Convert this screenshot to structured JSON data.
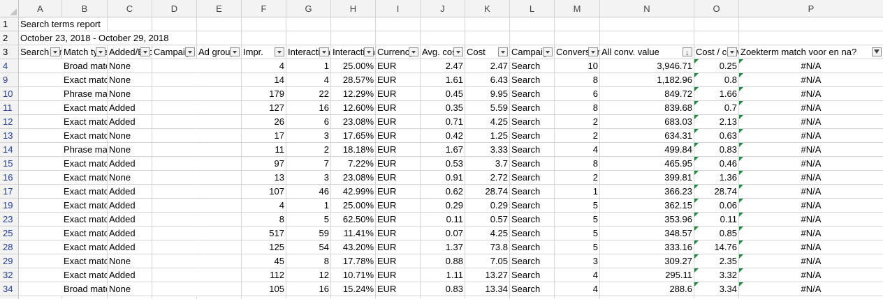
{
  "columns": [
    {
      "letter": "A",
      "width": 62
    },
    {
      "letter": "B",
      "width": 65
    },
    {
      "letter": "C",
      "width": 64
    },
    {
      "letter": "D",
      "width": 64
    },
    {
      "letter": "E",
      "width": 64
    },
    {
      "letter": "F",
      "width": 64
    },
    {
      "letter": "G",
      "width": 64
    },
    {
      "letter": "H",
      "width": 64
    },
    {
      "letter": "I",
      "width": 64
    },
    {
      "letter": "J",
      "width": 64
    },
    {
      "letter": "K",
      "width": 64
    },
    {
      "letter": "L",
      "width": 64
    },
    {
      "letter": "M",
      "width": 65
    },
    {
      "letter": "N",
      "width": 135
    },
    {
      "letter": "O",
      "width": 64
    },
    {
      "letter": "P",
      "width": 207
    }
  ],
  "title_row": {
    "row": "1",
    "text": "Search terms report"
  },
  "date_row": {
    "row": "2",
    "text": "October 23, 2018 - October 29, 2018"
  },
  "header_row": {
    "row": "3",
    "cells": [
      {
        "text": "Search terms",
        "filter": "dropdown"
      },
      {
        "text": "Match type",
        "filter": "dropdown"
      },
      {
        "text": "Added/Excluded",
        "filter": "dropdown"
      },
      {
        "text": "Campaign",
        "filter": "dropdown"
      },
      {
        "text": "Ad group",
        "filter": "dropdown"
      },
      {
        "text": "Impr.",
        "filter": "dropdown"
      },
      {
        "text": "Interactions",
        "filter": "dropdown"
      },
      {
        "text": "Interaction rate",
        "filter": "dropdown"
      },
      {
        "text": "Currency",
        "filter": "dropdown"
      },
      {
        "text": "Avg. cost",
        "filter": "dropdown"
      },
      {
        "text": "Cost",
        "filter": "dropdown"
      },
      {
        "text": "Campaign type",
        "filter": "dropdown"
      },
      {
        "text": "Conversions",
        "filter": "dropdown"
      },
      {
        "text": "All conv. value",
        "filter": "sorted"
      },
      {
        "text": "Cost / conv.",
        "filter": "dropdown"
      },
      {
        "text": "Zoekterm match voor en na?",
        "filter": "filtered"
      }
    ]
  },
  "data_rows": [
    {
      "row": "4",
      "cells": [
        "",
        "Broad match",
        "None",
        "",
        "",
        "4",
        "1",
        "25.00%",
        "EUR",
        "2.47",
        "2.47",
        "Search",
        "10",
        "3,946.71",
        "0.25",
        "#N/A"
      ]
    },
    {
      "row": "9",
      "cells": [
        "",
        "Exact match",
        "None",
        "",
        "",
        "14",
        "4",
        "28.57%",
        "EUR",
        "1.61",
        "6.43",
        "Search",
        "8",
        "1,182.96",
        "0.8",
        "#N/A"
      ]
    },
    {
      "row": "10",
      "cells": [
        "",
        "Phrase match",
        "None",
        "",
        "",
        "179",
        "22",
        "12.29%",
        "EUR",
        "0.45",
        "9.95",
        "Search",
        "6",
        "849.72",
        "1.66",
        "#N/A"
      ]
    },
    {
      "row": "11",
      "cells": [
        "",
        "Exact match",
        "Added",
        "",
        "",
        "127",
        "16",
        "12.60%",
        "EUR",
        "0.35",
        "5.59",
        "Search",
        "8",
        "839.68",
        "0.7",
        "#N/A"
      ]
    },
    {
      "row": "12",
      "cells": [
        "",
        "Exact match",
        "Added",
        "",
        "",
        "26",
        "6",
        "23.08%",
        "EUR",
        "0.71",
        "4.25",
        "Search",
        "2",
        "683.03",
        "2.13",
        "#N/A"
      ]
    },
    {
      "row": "13",
      "cells": [
        "",
        "Exact match",
        "None",
        "",
        "",
        "17",
        "3",
        "17.65%",
        "EUR",
        "0.42",
        "1.25",
        "Search",
        "2",
        "634.31",
        "0.63",
        "#N/A"
      ]
    },
    {
      "row": "14",
      "cells": [
        "",
        "Phrase match",
        "None",
        "",
        "",
        "11",
        "2",
        "18.18%",
        "EUR",
        "1.67",
        "3.33",
        "Search",
        "4",
        "499.84",
        "0.83",
        "#N/A"
      ]
    },
    {
      "row": "15",
      "cells": [
        "",
        "Exact match",
        "Added",
        "",
        "",
        "97",
        "7",
        "7.22%",
        "EUR",
        "0.53",
        "3.7",
        "Search",
        "8",
        "465.95",
        "0.46",
        "#N/A"
      ]
    },
    {
      "row": "16",
      "cells": [
        "",
        "Exact match",
        "None",
        "",
        "",
        "13",
        "3",
        "23.08%",
        "EUR",
        "0.91",
        "2.72",
        "Search",
        "2",
        "399.81",
        "1.36",
        "#N/A"
      ]
    },
    {
      "row": "17",
      "cells": [
        "",
        "Exact match",
        "Added",
        "",
        "",
        "107",
        "46",
        "42.99%",
        "EUR",
        "0.62",
        "28.74",
        "Search",
        "1",
        "366.23",
        "28.74",
        "#N/A"
      ]
    },
    {
      "row": "19",
      "cells": [
        "",
        "Exact match",
        "Added",
        "",
        "",
        "4",
        "1",
        "25.00%",
        "EUR",
        "0.29",
        "0.29",
        "Search",
        "5",
        "362.15",
        "0.06",
        "#N/A"
      ]
    },
    {
      "row": "23",
      "cells": [
        "",
        "Exact match",
        "Added",
        "",
        "",
        "8",
        "5",
        "62.50%",
        "EUR",
        "0.11",
        "0.57",
        "Search",
        "5",
        "353.96",
        "0.11",
        "#N/A"
      ]
    },
    {
      "row": "25",
      "cells": [
        "",
        "Exact match",
        "Added",
        "",
        "",
        "517",
        "59",
        "11.41%",
        "EUR",
        "0.07",
        "4.25",
        "Search",
        "5",
        "348.57",
        "0.85",
        "#N/A"
      ]
    },
    {
      "row": "28",
      "cells": [
        "",
        "Exact match",
        "Added",
        "",
        "",
        "125",
        "54",
        "43.20%",
        "EUR",
        "1.37",
        "73.8",
        "Search",
        "5",
        "333.16",
        "14.76",
        "#N/A"
      ]
    },
    {
      "row": "29",
      "cells": [
        "",
        "Exact match",
        "None",
        "",
        "",
        "45",
        "8",
        "17.78%",
        "EUR",
        "0.88",
        "7.05",
        "Search",
        "3",
        "309.27",
        "2.35",
        "#N/A"
      ]
    },
    {
      "row": "32",
      "cells": [
        "",
        "Exact match",
        "Added",
        "",
        "",
        "112",
        "12",
        "10.71%",
        "EUR",
        "1.11",
        "13.27",
        "Search",
        "4",
        "295.11",
        "3.32",
        "#N/A"
      ]
    },
    {
      "row": "34",
      "cells": [
        "",
        "Broad match",
        "None",
        "",
        "",
        "105",
        "16",
        "15.24%",
        "EUR",
        "0.83",
        "13.34",
        "Search",
        "4",
        "288.6",
        "3.34",
        "#N/A"
      ]
    }
  ],
  "colors": {
    "header_bg": "#f3f3f3",
    "gridline": "#d4d4d4",
    "filtered_row_number": "#1f3fa6",
    "error_indicator": "#1e8a3c"
  },
  "icons": {
    "filter_button": "chevron-down-icon",
    "sorted_button": "sort-descending-icon",
    "filtered_button": "funnel-icon",
    "error_indicator": "green-triangle-icon"
  }
}
